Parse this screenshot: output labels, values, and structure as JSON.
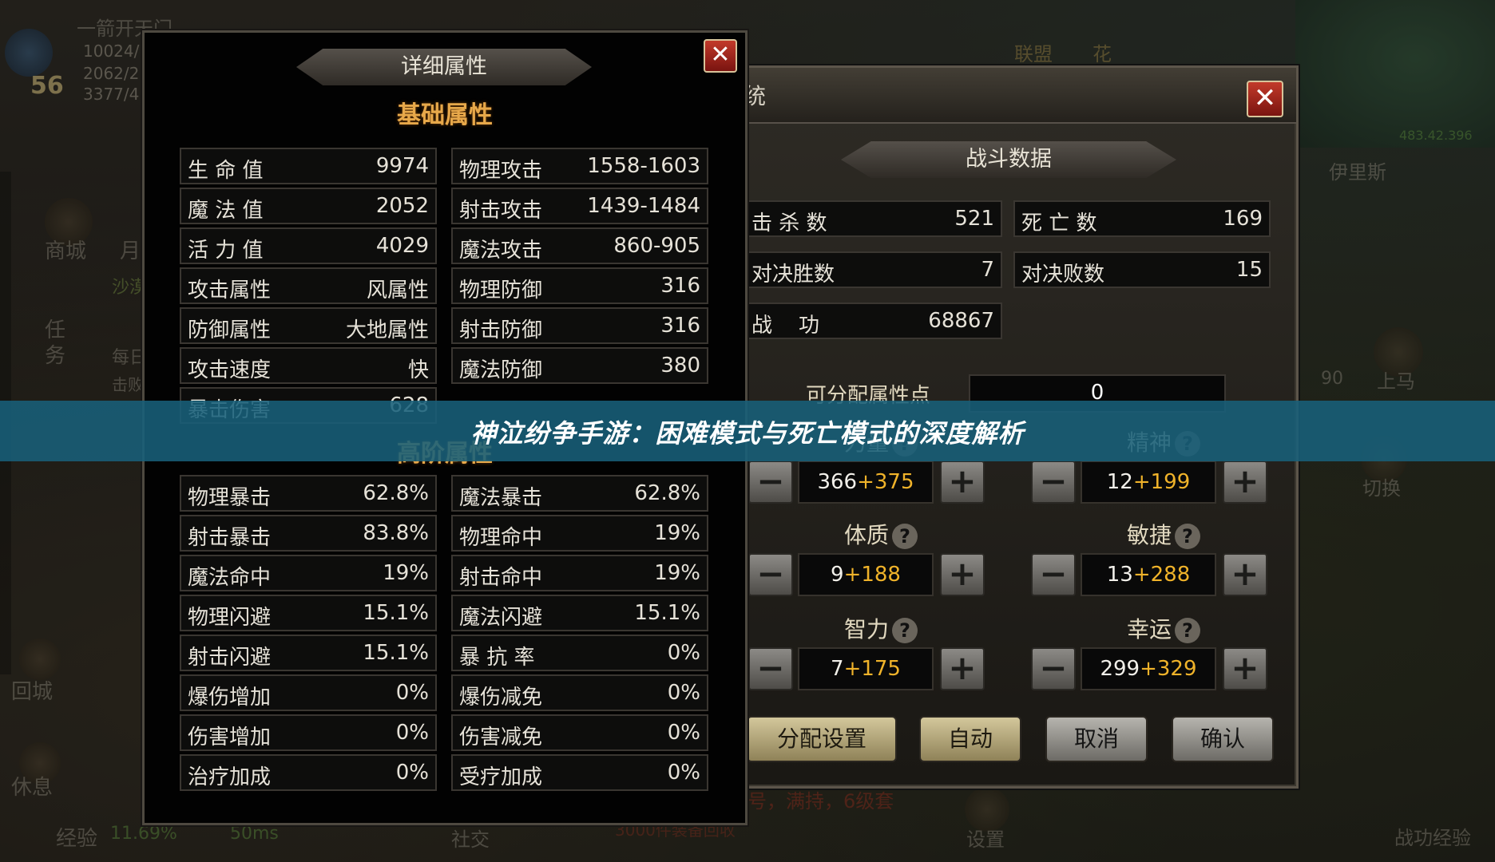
{
  "background": {
    "player_name": "一箭开天门",
    "player_level": "56",
    "hp_text": "10024/",
    "mp_text": "2062/2",
    "exp_text": "3377/4",
    "side_labels": [
      "商城",
      "月",
      "任务",
      "回城",
      "休息"
    ],
    "quest_items": [
      "沙漠",
      "每日",
      "击败"
    ],
    "bottom_labels": [
      "经验",
      "11.69%",
      "50ms",
      "社交",
      "设置",
      "战功经验"
    ],
    "top_right_labels": [
      "联盟",
      "花"
    ],
    "map_name": "伊里斯",
    "map_coords": "483.42.396",
    "right_labels": [
      "上马",
      "切换"
    ],
    "right_number": "90",
    "faint_red_text": "号，满持，6级套",
    "faint_red_text2": "3000件装备回收"
  },
  "left_panel": {
    "title": "详细属性",
    "section1": "基础属性",
    "section2": "高阶属性",
    "close_symbol": "✕",
    "basic_left": [
      {
        "label": "生 命 值",
        "value": "9974"
      },
      {
        "label": "魔 法 值",
        "value": "2052"
      },
      {
        "label": "活 力 值",
        "value": "4029"
      },
      {
        "label": "攻击属性",
        "value": "风属性"
      },
      {
        "label": "防御属性",
        "value": "大地属性"
      },
      {
        "label": "攻击速度",
        "value": "快"
      },
      {
        "label": "暴击伤害",
        "value": "628"
      }
    ],
    "basic_right": [
      {
        "label": "物理攻击",
        "value": "1558-1603"
      },
      {
        "label": "射击攻击",
        "value": "1439-1484"
      },
      {
        "label": "魔法攻击",
        "value": "860-905"
      },
      {
        "label": "物理防御",
        "value": "316"
      },
      {
        "label": "射击防御",
        "value": "316"
      },
      {
        "label": "魔法防御",
        "value": "380"
      }
    ],
    "adv_left": [
      {
        "label": "物理暴击",
        "value": "62.8%"
      },
      {
        "label": "射击暴击",
        "value": "83.8%"
      },
      {
        "label": "魔法命中",
        "value": "19%"
      },
      {
        "label": "物理闪避",
        "value": "15.1%"
      },
      {
        "label": "射击闪避",
        "value": "15.1%"
      },
      {
        "label": "爆伤增加",
        "value": "0%"
      },
      {
        "label": "伤害增加",
        "value": "0%"
      },
      {
        "label": "治疗加成",
        "value": "0%"
      }
    ],
    "adv_right": [
      {
        "label": "魔法暴击",
        "value": "62.8%"
      },
      {
        "label": "物理命中",
        "value": "19%"
      },
      {
        "label": "射击命中",
        "value": "19%"
      },
      {
        "label": "魔法闪避",
        "value": "15.1%"
      },
      {
        "label": "暴 抗 率",
        "value": "0%"
      },
      {
        "label": "爆伤减免",
        "value": "0%"
      },
      {
        "label": "伤害减免",
        "value": "0%"
      },
      {
        "label": "受疗加成",
        "value": "0%"
      }
    ]
  },
  "right_panel": {
    "header_fragment": "统",
    "close_symbol": "✕",
    "battle_title": "战斗数据",
    "battle_stats": [
      {
        "label": "击 杀 数",
        "value": "521"
      },
      {
        "label": "死 亡 数",
        "value": "169"
      },
      {
        "label": "对决胜数",
        "value": "7"
      },
      {
        "label": "对决败数",
        "value": "15"
      },
      {
        "label": "战    功",
        "value": "68867"
      }
    ],
    "alloc_label": "可分配属性点",
    "alloc_value": "0",
    "help_symbol": "?",
    "minus_symbol": "−",
    "plus_symbol": "+",
    "attributes": [
      {
        "name": "力量",
        "base": "366",
        "bonus": "+375"
      },
      {
        "name": "精神",
        "base": "12",
        "bonus": "+199"
      },
      {
        "name": "体质",
        "base": "9",
        "bonus": "+188"
      },
      {
        "name": "敏捷",
        "base": "13",
        "bonus": "+288"
      },
      {
        "name": "智力",
        "base": "7",
        "bonus": "+175"
      },
      {
        "name": "幸运",
        "base": "299",
        "bonus": "+329"
      }
    ],
    "buttons": {
      "alloc_settings": "分配设置",
      "auto": "自动",
      "cancel": "取消",
      "confirm": "确认"
    }
  },
  "overlay": {
    "title": "神泣纷争手游：困难模式与死亡模式的深度解析"
  },
  "colors": {
    "bonus": "#f0b32a",
    "overlay": "#18607a",
    "subtitle": "#e7a84a"
  }
}
